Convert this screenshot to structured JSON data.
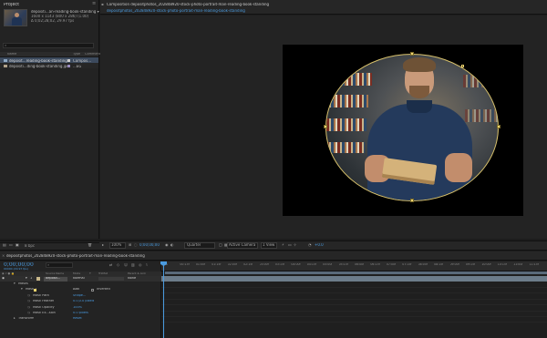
{
  "project": {
    "tab_label": "Project",
    "menu_glyph": "≡",
    "meta_name": "depositi...an-reading-book-standing ▾",
    "meta_dims": "1600 x 1143 (800 x 286) (1.00)",
    "meta_time": "Δ 0;02;28;02, 29.97 fps",
    "search_placeholder": "",
    "columns": [
      "Name",
      "Type",
      "Comment"
    ],
    "items": [
      {
        "name": "deposit...reading-book-standing",
        "type": "Compos..."
      },
      {
        "name": "depositi...ding-book-standing.jpg",
        "type": "...EG"
      }
    ],
    "bpc": "8 bpc"
  },
  "composition": {
    "tab_title": "Composition depositphotos_202848920-stock-photo-portrait-man-reading-book-standing",
    "subtab": "depositphotos_202848920-stock-photo-portrait-man-reading-book-standing"
  },
  "viewer": {
    "zoom": "100%",
    "timecode": "0;00;00;00",
    "resolution": "Quarter",
    "camera": "Active Camera",
    "views": "1 View",
    "exposure": "+0.0"
  },
  "timeline": {
    "tab": "depositphotos_202848920-stock-photo-portrait-man-reading-book-standing",
    "timecode": "0;00;00;00",
    "frames": "00000 (29.97 fps)",
    "col_headers": [
      "Source Name",
      "Mode",
      "T",
      "TrkMat",
      "Parent & Link"
    ],
    "layer": {
      "num": "1",
      "name": "deposit...",
      "mode": "Normal",
      "parent": "None"
    },
    "props": [
      {
        "label": "Masks",
        "value": ""
      },
      {
        "label": "Mask 1",
        "value": "Add",
        "extra": "Inverted"
      },
      {
        "label": "Mask Path",
        "value": "Shape..."
      },
      {
        "label": "Mask Feather",
        "value": "0.0,0.0 pixels"
      },
      {
        "label": "Mask Opacity",
        "value": "100%"
      },
      {
        "label": "Mask Ex...sion",
        "value": "0.0 pixels"
      },
      {
        "label": "Transform",
        "value": "Reset"
      }
    ],
    "ruler_ticks": [
      "0s",
      "00:15f",
      "01:00f",
      "01:15f",
      "02:00f",
      "02:15f",
      "03:00f",
      "03:15f",
      "04:00f",
      "04:15f",
      "05:00f",
      "05:15f",
      "06:00f",
      "06:15f",
      "07:00f",
      "07:15f",
      "08:00f",
      "08:15f",
      "09:00f",
      "09:15f",
      "10:00f",
      "10:15f",
      "11:00f",
      "11:15f"
    ]
  }
}
